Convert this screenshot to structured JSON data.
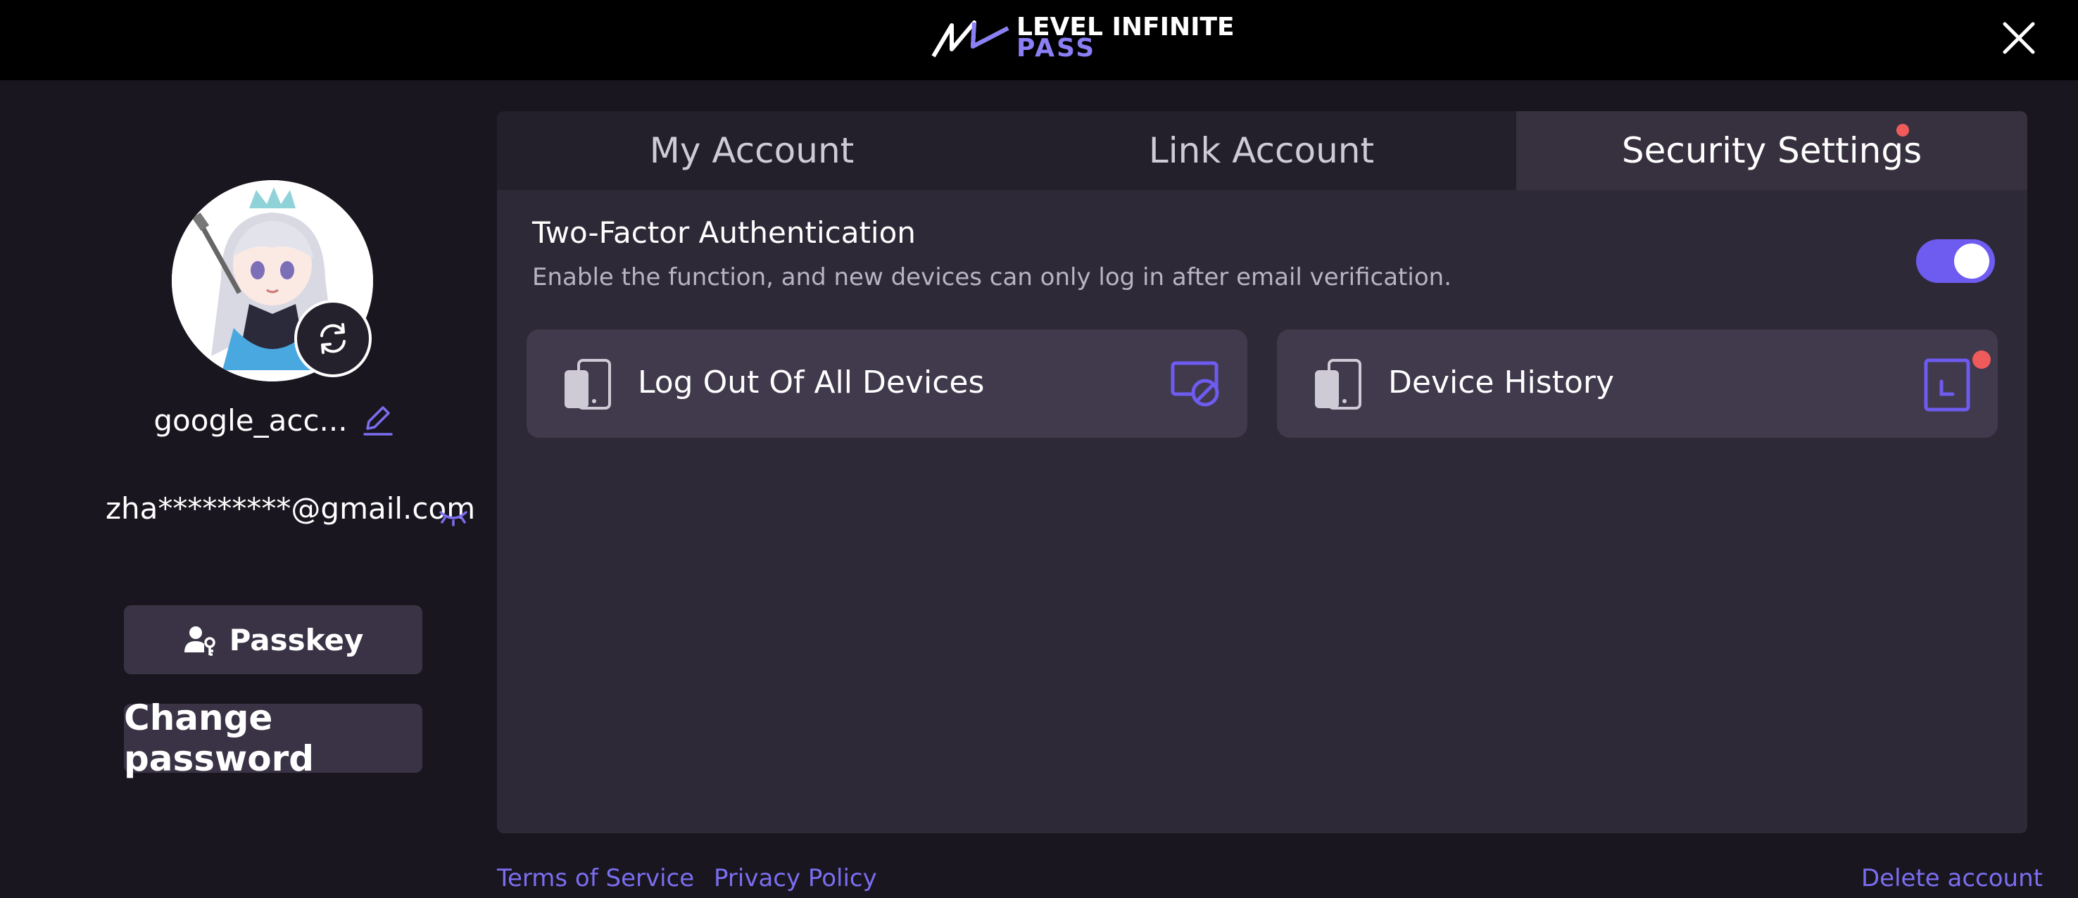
{
  "header": {
    "brand_line1": "LEVEL INFINITE",
    "brand_line2": "PASS"
  },
  "profile": {
    "username": "google_acc...",
    "email": "zha*********@gmail.com"
  },
  "buttons": {
    "passkey": "Passkey",
    "change_password": "Change password"
  },
  "tabs": [
    {
      "label": "My Account",
      "active": false
    },
    {
      "label": "Link Account",
      "active": false
    },
    {
      "label": "Security Settings",
      "active": true
    }
  ],
  "security": {
    "tfa_title": "Two-Factor Authentication",
    "tfa_description": "Enable the function, and new devices can only log in after email verification.",
    "tfa_enabled": true,
    "cards": [
      {
        "label": "Log Out Of All Devices"
      },
      {
        "label": "Device History"
      }
    ]
  },
  "footer": {
    "terms": "Terms of Service",
    "privacy": "Privacy Policy",
    "delete": "Delete account"
  },
  "colors": {
    "accent": "#6e5bf0",
    "link": "#7b6ef0",
    "notification": "#ef5b5b",
    "background": "#19161f",
    "panel": "#2e2937"
  }
}
